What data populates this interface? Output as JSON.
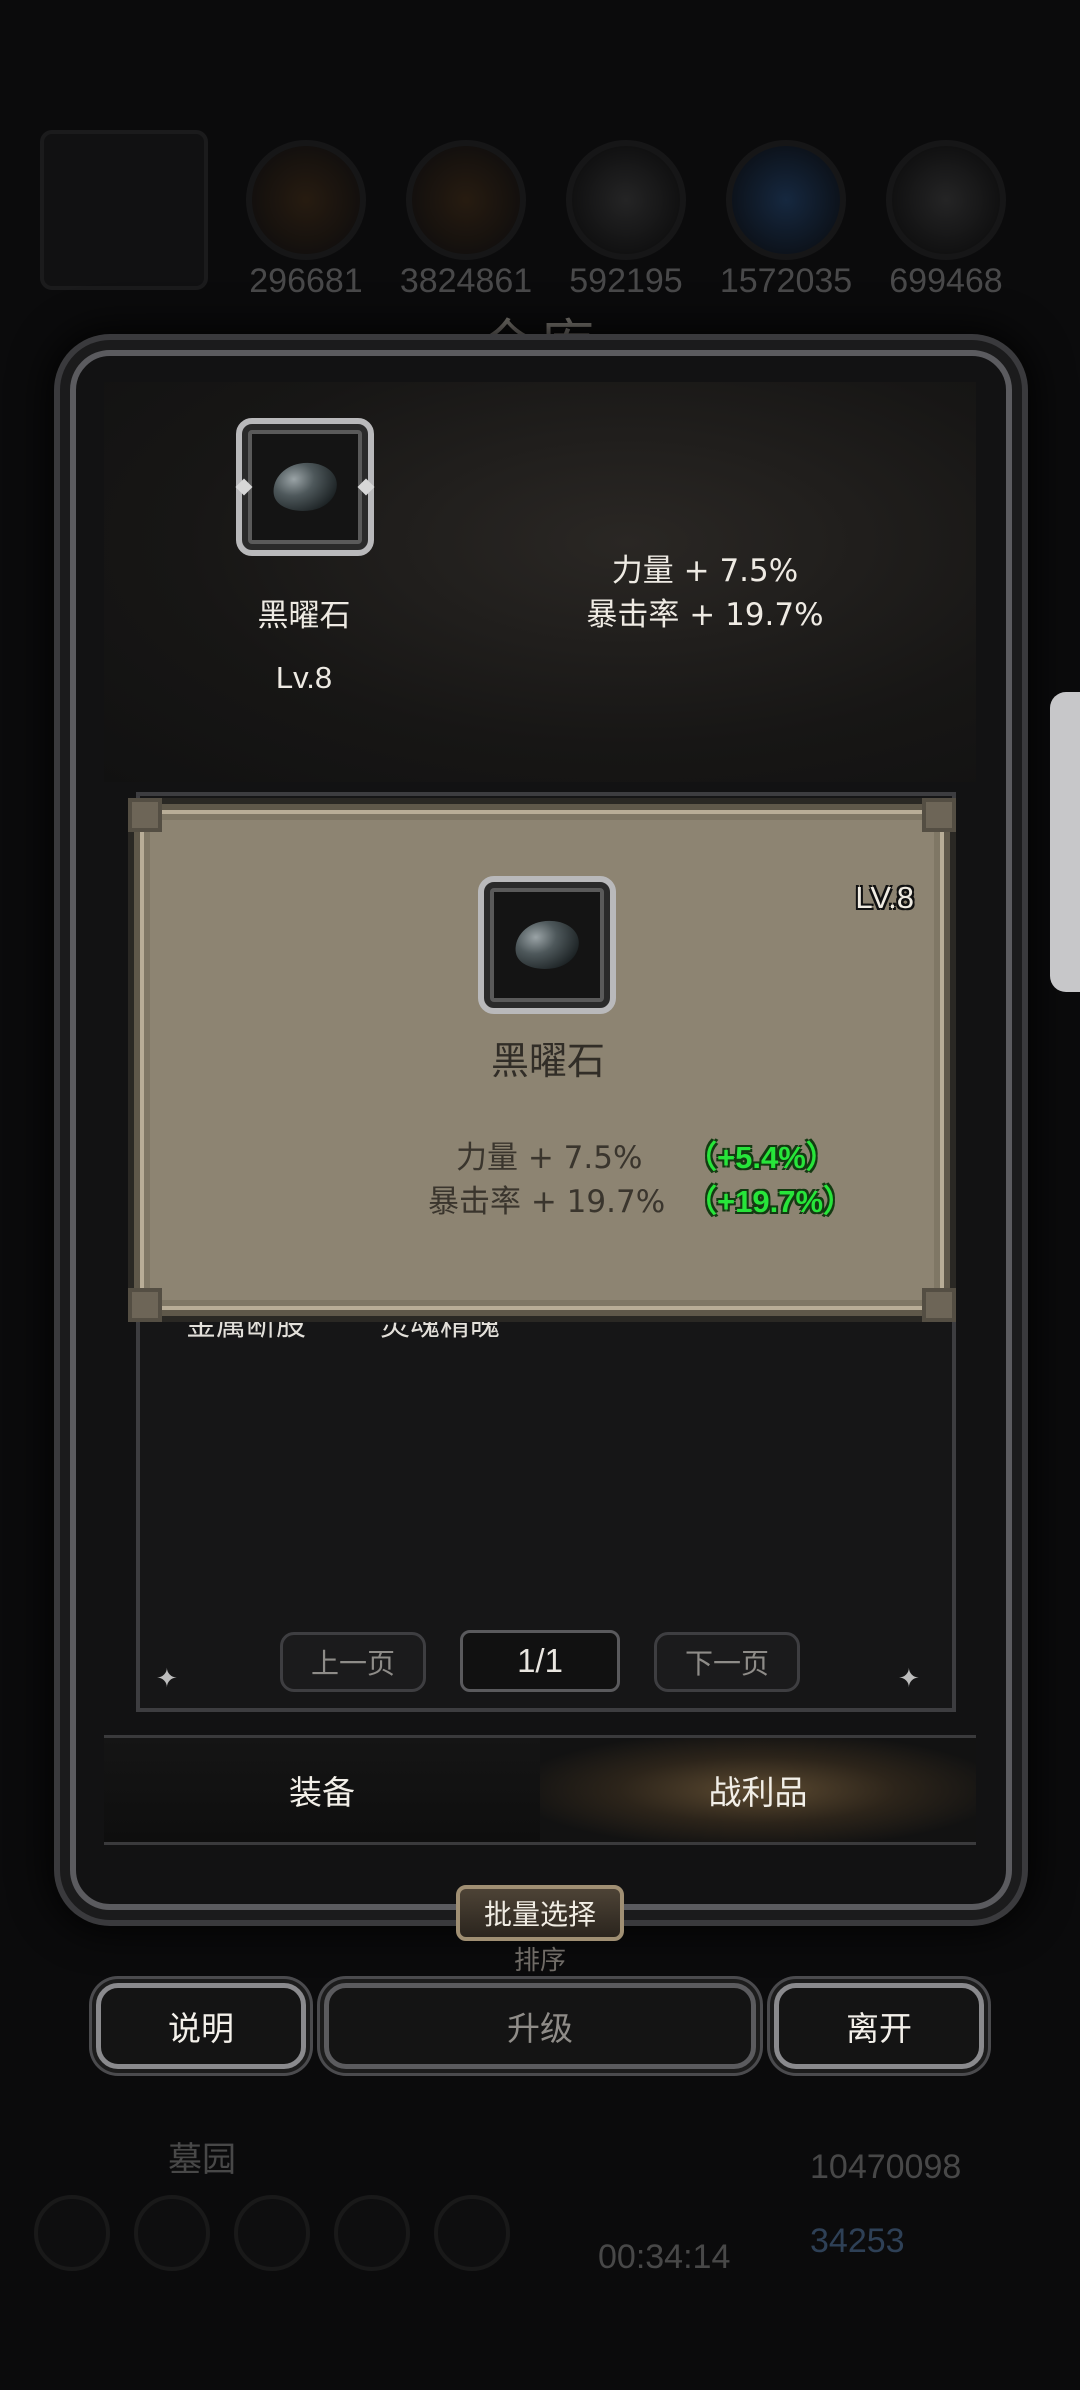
{
  "background": {
    "resources": [
      "296681",
      "3824861",
      "592195",
      "1572035",
      "699468"
    ],
    "location": "墓园",
    "timer": "00:34:14",
    "gold": "10470098",
    "gems": "34253"
  },
  "window": {
    "title": "仓库"
  },
  "selected_item": {
    "name": "黑曜石",
    "level": "Lv.8",
    "stats": [
      "力量 + 7.5%",
      "暴击率 + 19.7%"
    ]
  },
  "list": {
    "items": [
      "金属断股",
      "灵魂精魄"
    ]
  },
  "tooltip": {
    "level": "LV.8",
    "name": "黑曜石",
    "stats": [
      {
        "label": "力量 + 7.5%",
        "bonus": "（+5.4%）"
      },
      {
        "label": "暴击率 + 19.7%",
        "bonus": "（+19.7%）"
      }
    ],
    "colors": {
      "bonus": "#27e53a",
      "panel": "#8d8472"
    }
  },
  "pagination": {
    "prev_label": "上一页",
    "current": "1/1",
    "next_label": "下一页"
  },
  "tabs": [
    {
      "label": "装备",
      "active": false
    },
    {
      "label": "战利品",
      "active": true
    }
  ],
  "batch_select_label": "批量选择",
  "sort_label": "排序",
  "buttons": {
    "help": "说明",
    "upgrade": "升级",
    "leave": "离开"
  }
}
